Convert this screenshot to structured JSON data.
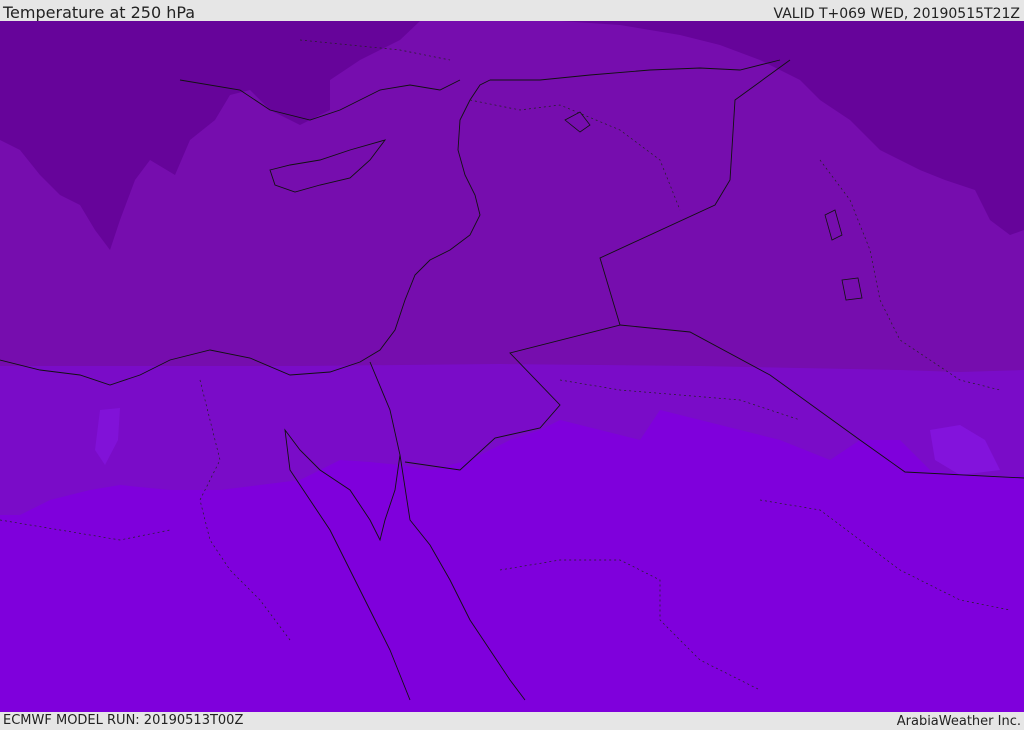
{
  "header": {
    "title": "Temperature at 250 hPa",
    "valid": "VALID T+069 WED, 20190515T21Z"
  },
  "footer": {
    "model_run": "ECMWF MODEL RUN: 20190513T00Z",
    "credit": "ArabiaWeather Inc."
  },
  "map": {
    "colors": {
      "band_coldest": "#66049a",
      "band_cold": "#760dae",
      "band_mid": "#7a0cc8",
      "band_warm": "#7f00dc",
      "band_patch": "#8a1aec",
      "border": "#111111"
    }
  }
}
